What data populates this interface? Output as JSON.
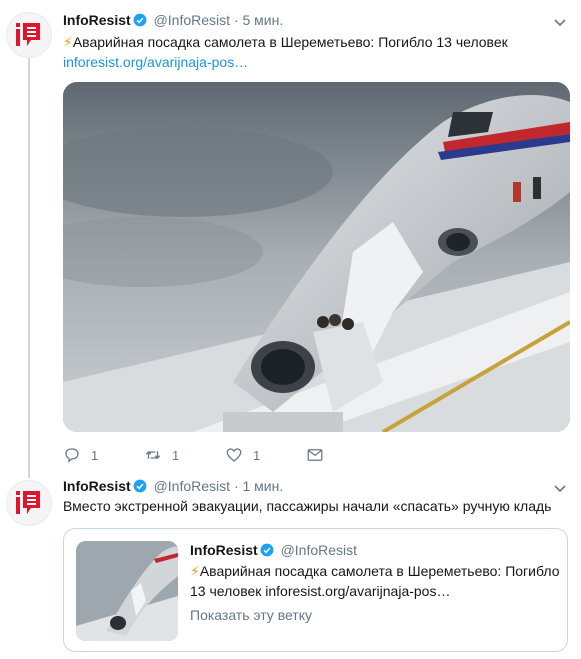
{
  "tweets": [
    {
      "author": "InfoResist",
      "handle": "@InfoResist",
      "separator": "·",
      "time": "5 мин.",
      "emoji": "⚡",
      "text": "Аварийная посадка самолета в Шереметьево: Погибло 13 человек",
      "link": "inforesist.org/avarijnaja-pos…",
      "actions": {
        "replies": "1",
        "retweets": "1",
        "likes": "1"
      }
    },
    {
      "author": "InfoResist",
      "handle": "@InfoResist",
      "separator": "·",
      "time": "1 мин.",
      "text": "Вместо экстренной эвакуации, пассажиры начали «спасать» ручную кладь",
      "quote": {
        "author": "InfoResist",
        "handle": "@InfoResist",
        "emoji": "⚡",
        "text": "Аварийная посадка самолета в Шереметьево: Погибло 13 человек inforesist.org/avarijnaja-pos…",
        "show_thread": "Показать эту ветку"
      }
    }
  ],
  "icons": {
    "avatar": "inforesist-logo-icon",
    "verified": "verified-badge-icon",
    "caret": "chevron-down-icon",
    "reply": "reply-icon",
    "retweet": "retweet-icon",
    "like": "heart-icon",
    "dm": "envelope-icon"
  },
  "colors": {
    "accent": "#1b95e0",
    "muted": "#657786",
    "logo_red": "#e0142d",
    "border": "#ccd6dd"
  }
}
